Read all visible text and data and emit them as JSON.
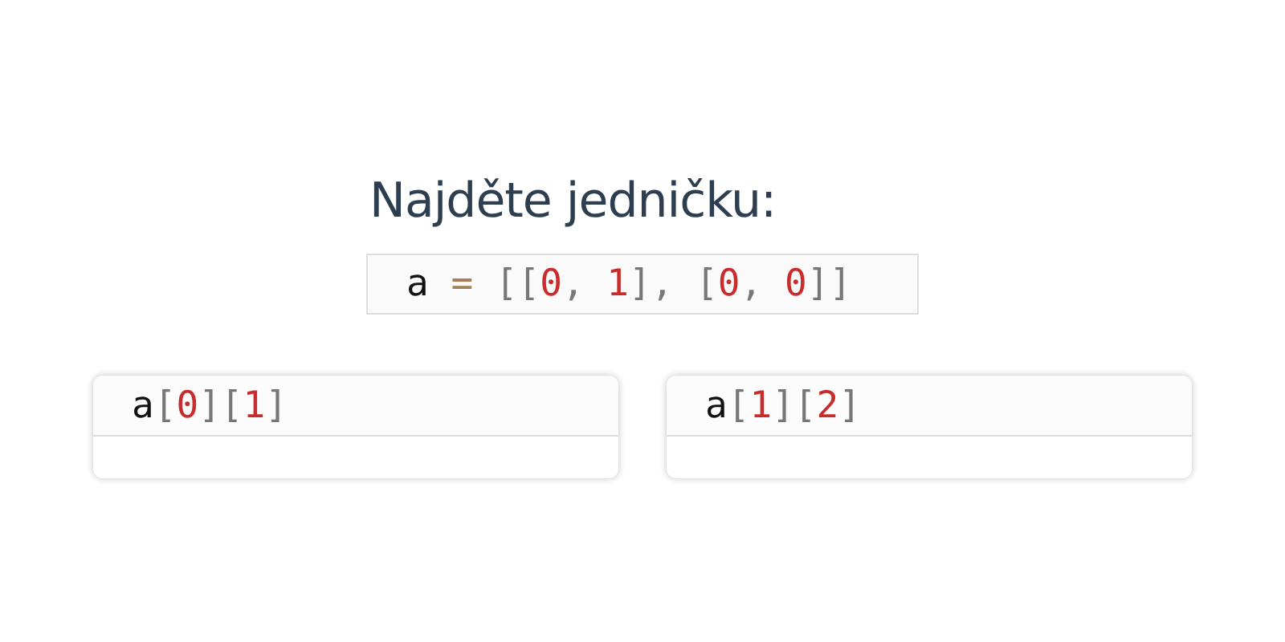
{
  "question": {
    "title": "Najděte jedničku:",
    "code": [
      {
        "kind": "name",
        "text": "a"
      },
      {
        "kind": "operator",
        "text": " = "
      },
      {
        "kind": "punct",
        "text": "[["
      },
      {
        "kind": "number",
        "text": "0"
      },
      {
        "kind": "punct",
        "text": ", "
      },
      {
        "kind": "number",
        "text": "1"
      },
      {
        "kind": "punct",
        "text": "], ["
      },
      {
        "kind": "number",
        "text": "0"
      },
      {
        "kind": "punct",
        "text": ", "
      },
      {
        "kind": "number",
        "text": "0"
      },
      {
        "kind": "punct",
        "text": "]]"
      }
    ]
  },
  "options": [
    {
      "code": [
        {
          "kind": "name",
          "text": "a"
        },
        {
          "kind": "punct",
          "text": "["
        },
        {
          "kind": "number",
          "text": "0"
        },
        {
          "kind": "punct",
          "text": "]["
        },
        {
          "kind": "number",
          "text": "1"
        },
        {
          "kind": "punct",
          "text": "]"
        }
      ]
    },
    {
      "code": [
        {
          "kind": "name",
          "text": "a"
        },
        {
          "kind": "punct",
          "text": "["
        },
        {
          "kind": "number",
          "text": "1"
        },
        {
          "kind": "punct",
          "text": "]["
        },
        {
          "kind": "number",
          "text": "2"
        },
        {
          "kind": "punct",
          "text": "]"
        }
      ]
    }
  ]
}
